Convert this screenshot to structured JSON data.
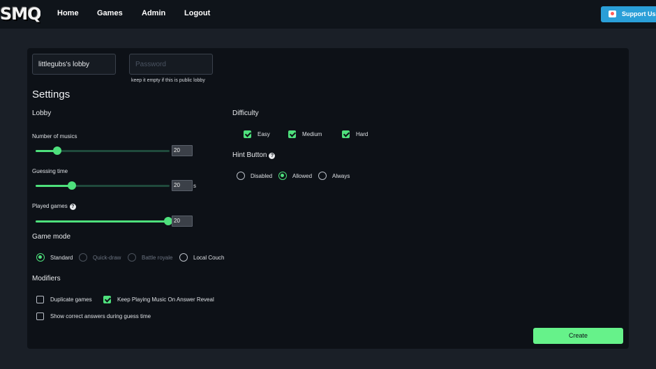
{
  "nav": {
    "logo": "SMQ",
    "links": [
      "Home",
      "Games",
      "Admin",
      "Logout"
    ],
    "support_label": "Support Us!"
  },
  "lobby": {
    "name_value": "littlegubs's lobby",
    "password_placeholder": "Password",
    "password_hint": "keep it empty if this is public lobby"
  },
  "settings": {
    "title": "Settings",
    "lobby_heading": "Lobby",
    "sliders": [
      {
        "label": "Number of musics",
        "value": "20",
        "fill_fraction": 0.16,
        "unit": "",
        "help": false
      },
      {
        "label": "Guessing time",
        "value": "20",
        "fill_fraction": 0.27,
        "unit": "s",
        "help": false
      },
      {
        "label": "Played games",
        "value": "20",
        "fill_fraction": 1.0,
        "unit": "",
        "help": true
      }
    ],
    "game_mode": {
      "heading": "Game mode",
      "options": [
        {
          "label": "Standard",
          "selected": true,
          "disabled": false
        },
        {
          "label": "Quick-draw",
          "selected": false,
          "disabled": true
        },
        {
          "label": "Battle royale",
          "selected": false,
          "disabled": true
        },
        {
          "label": "Local Couch",
          "selected": false,
          "disabled": false
        }
      ]
    },
    "modifiers": {
      "heading": "Modifiers",
      "options": [
        {
          "label": "Duplicate games",
          "checked": false
        },
        {
          "label": "Keep Playing Music On Answer Reveal",
          "checked": true
        },
        {
          "label": "Show correct answers during guess time",
          "checked": false
        }
      ]
    },
    "difficulty": {
      "heading": "Difficulty",
      "options": [
        {
          "label": "Easy",
          "checked": true
        },
        {
          "label": "Medium",
          "checked": true
        },
        {
          "label": "Hard",
          "checked": true
        }
      ]
    },
    "hint_button": {
      "heading": "Hint Button",
      "options": [
        {
          "label": "Disabled",
          "selected": false
        },
        {
          "label": "Allowed",
          "selected": true
        },
        {
          "label": "Always",
          "selected": false
        }
      ]
    },
    "create_label": "Create"
  },
  "colors": {
    "accent": "#4ee07c",
    "create_button": "#66f28a",
    "support_button": "#2a9fd8",
    "background": "#1a1f27",
    "panel": "#0d1117"
  }
}
